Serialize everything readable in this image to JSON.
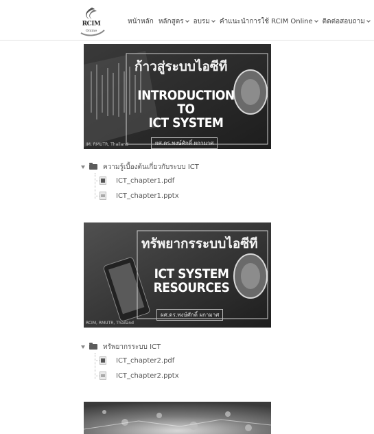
{
  "header": {
    "logo_text": "RCIM",
    "logo_sub": "Online",
    "menu": [
      {
        "label": "หน้าหลัก",
        "dropdown": false
      },
      {
        "label": "หลักสูตร",
        "dropdown": true
      },
      {
        "label": "อบรม",
        "dropdown": true
      },
      {
        "label": "คำแนะนำการใช้ RCIM Online",
        "dropdown": true
      },
      {
        "label": "ติดต่อสอบถาม",
        "dropdown": true
      }
    ]
  },
  "sections": [
    {
      "banner": {
        "thai_title": "ก้าวสู่ระบบไอซีที",
        "en_line1": "INTRODUCTION TO",
        "en_line2": "ICT SYSTEM",
        "author": "ผศ.ดร.พงษ์ศักดิ์ ผกามาศ",
        "watermark": "IM, RMUTR, Thailand"
      },
      "folder": "ความรู้เบื้องต้นเกี่ยวกับระบบ ICT",
      "files": [
        {
          "name": "ICT_chapter1.pdf",
          "type": "pdf"
        },
        {
          "name": "ICT_chapter1.pptx",
          "type": "pptx"
        }
      ]
    },
    {
      "banner": {
        "thai_title": "ทรัพยากรระบบไอซีที",
        "en_line1": "ICT SYSTEM",
        "en_line2": "RESOURCES",
        "author": "ผศ.ดร.พงษ์ศักดิ์ ผกามาศ",
        "watermark": "RCIM, RMUTR, Thailand"
      },
      "folder": "ทรัพยากรระบบ ICT",
      "files": [
        {
          "name": "ICT_chapter2.pdf",
          "type": "pdf"
        },
        {
          "name": "ICT_chapter2.pptx",
          "type": "pptx"
        }
      ]
    }
  ]
}
